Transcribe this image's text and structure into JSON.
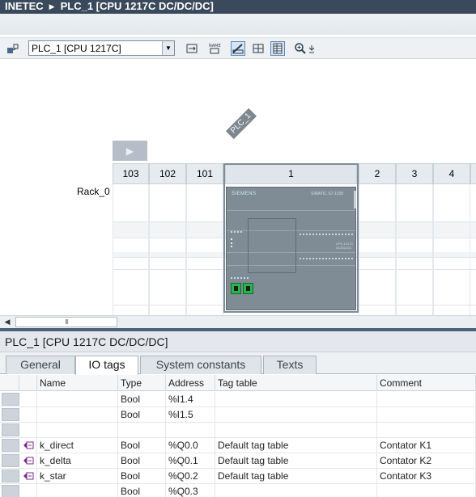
{
  "window": {
    "breadcrumb": [
      "INETEC",
      "PLC_1 [CPU 1217C DC/DC/DC]"
    ]
  },
  "toolbar": {
    "device_select": "PLC_1 [CPU 1217C]",
    "icons": [
      "network-add-icon",
      "fit-view-icon",
      "show-names-icon",
      "toggle-labels-icon",
      "grid-icon",
      "table-icon",
      "zoom-icon",
      "zoom-dropdown-icon"
    ],
    "zoom_symbol": "⊕"
  },
  "canvas": {
    "plc_label": "PLC_1",
    "rack_label": "Rack_0",
    "slots": [
      "103",
      "102",
      "101",
      "1",
      "2",
      "3",
      "4"
    ],
    "cpu_brand": "SIEMENS",
    "cpu_model": "SIMATIC S7-1200",
    "cpu_text": "CPU 1217C DC/DC/DC"
  },
  "scrollbar": {
    "thumb": "III"
  },
  "properties": {
    "title": "PLC_1 [CPU 1217C DC/DC/DC]",
    "tabs": [
      "General",
      "IO tags",
      "System constants",
      "Texts"
    ],
    "active_tab": "IO tags",
    "columns": [
      "Name",
      "Type",
      "Address",
      "Tag table",
      "Comment"
    ],
    "rows": [
      {
        "has_icon": false,
        "name": "",
        "type": "Bool",
        "address": "%I1.4",
        "tag_table": "",
        "comment": ""
      },
      {
        "has_icon": false,
        "name": "",
        "type": "Bool",
        "address": "%I1.5",
        "tag_table": "",
        "comment": ""
      },
      {
        "has_icon": false,
        "name": "",
        "type": "",
        "address": "",
        "tag_table": "",
        "comment": ""
      },
      {
        "has_icon": true,
        "name": "k_direct",
        "type": "Bool",
        "address": "%Q0.0",
        "tag_table": "Default tag table",
        "comment": "Contator K1"
      },
      {
        "has_icon": true,
        "name": "k_delta",
        "type": "Bool",
        "address": "%Q0.1",
        "tag_table": "Default tag table",
        "comment": "Contator K2"
      },
      {
        "has_icon": true,
        "name": "k_star",
        "type": "Bool",
        "address": "%Q0.2",
        "tag_table": "Default tag table",
        "comment": "Contator K3"
      },
      {
        "has_icon": false,
        "name": "",
        "type": "Bool",
        "address": "%Q0.3",
        "tag_table": "",
        "comment": ""
      }
    ]
  },
  "colors": {
    "titlebar": "#3a4a5c",
    "divider": "#4e6278",
    "port_green": "#2ab44a",
    "tag_icon": "#7b2a8c"
  }
}
